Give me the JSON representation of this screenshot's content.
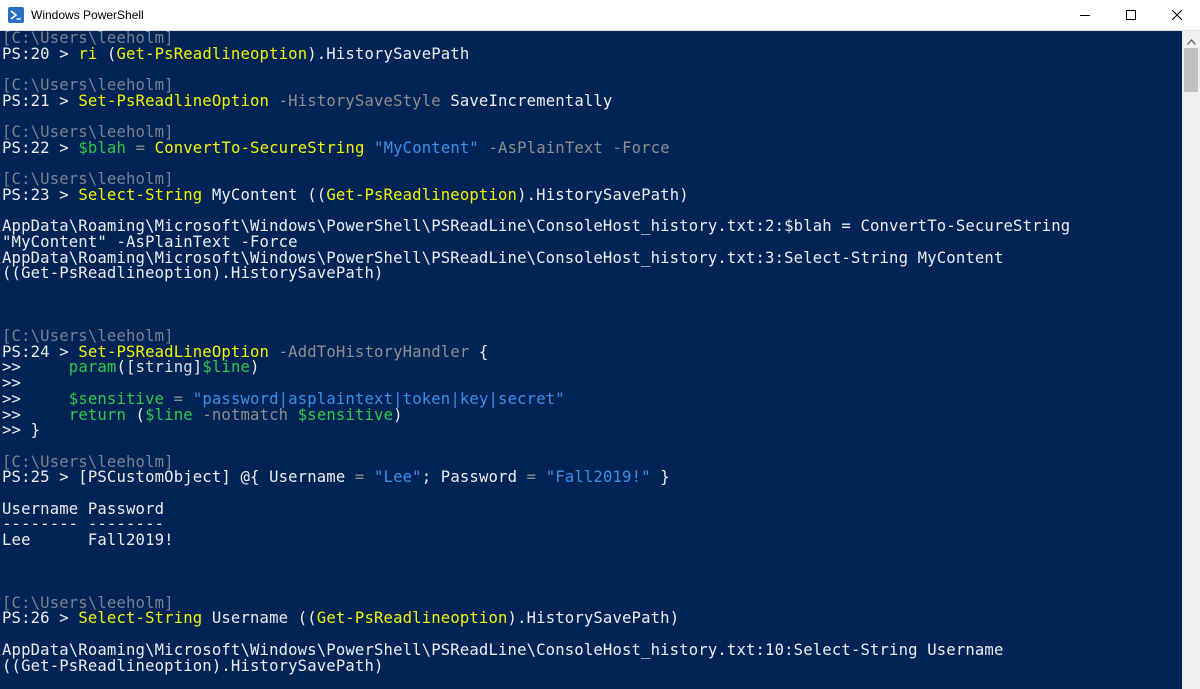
{
  "window": {
    "title": "Windows PowerShell",
    "icons": {
      "app": "powershell-icon",
      "minimize": "minimize-icon",
      "maximize": "maximize-icon",
      "close": "close-icon",
      "scroll_up": "chevron-up-icon"
    }
  },
  "colors": {
    "background": "#012456",
    "text": "#eeedf0",
    "prompt_path": "#7a8190",
    "command": "#f5f500",
    "parameter": "#8f8f8f",
    "variable": "#2ec84b",
    "string": "#3f8de6"
  },
  "console": {
    "lines": [
      [
        {
          "t": "[C:\\Users\\leeholm]",
          "c": "prompt"
        }
      ],
      [
        {
          "t": "PS:20 > "
        },
        {
          "t": "ri",
          "c": "cmd"
        },
        {
          "t": " ("
        },
        {
          "t": "Get-PsReadlineoption",
          "c": "cmd"
        },
        {
          "t": ").HistorySavePath"
        }
      ],
      [],
      [
        {
          "t": "[C:\\Users\\leeholm]",
          "c": "prompt"
        }
      ],
      [
        {
          "t": "PS:21 > "
        },
        {
          "t": "Set-PsReadlineOption",
          "c": "cmd"
        },
        {
          "t": " "
        },
        {
          "t": "-HistorySaveStyle",
          "c": "param"
        },
        {
          "t": " SaveIncrementally"
        }
      ],
      [],
      [
        {
          "t": "[C:\\Users\\leeholm]",
          "c": "prompt"
        }
      ],
      [
        {
          "t": "PS:22 > "
        },
        {
          "t": "$blah",
          "c": "var"
        },
        {
          "t": " "
        },
        {
          "t": "=",
          "c": "param"
        },
        {
          "t": " "
        },
        {
          "t": "ConvertTo-SecureString",
          "c": "cmd"
        },
        {
          "t": " "
        },
        {
          "t": "\"MyContent\"",
          "c": "str"
        },
        {
          "t": " "
        },
        {
          "t": "-AsPlainText",
          "c": "param"
        },
        {
          "t": " "
        },
        {
          "t": "-Force",
          "c": "param"
        }
      ],
      [],
      [
        {
          "t": "[C:\\Users\\leeholm]",
          "c": "prompt"
        }
      ],
      [
        {
          "t": "PS:23 > "
        },
        {
          "t": "Select-String",
          "c": "cmd"
        },
        {
          "t": " MyContent (("
        },
        {
          "t": "Get-PsReadlineoption",
          "c": "cmd"
        },
        {
          "t": ").HistorySavePath)"
        }
      ],
      [],
      [
        {
          "t": "AppData\\Roaming\\Microsoft\\Windows\\PowerShell\\PSReadLine\\ConsoleHost_history.txt:2:$blah = ConvertTo-SecureString"
        }
      ],
      [
        {
          "t": "\"MyContent\" -AsPlainText -Force"
        }
      ],
      [
        {
          "t": "AppData\\Roaming\\Microsoft\\Windows\\PowerShell\\PSReadLine\\ConsoleHost_history.txt:3:Select-String MyContent"
        }
      ],
      [
        {
          "t": "((Get-PsReadlineoption).HistorySavePath)"
        }
      ],
      [],
      [],
      [],
      [
        {
          "t": "[C:\\Users\\leeholm]",
          "c": "prompt"
        }
      ],
      [
        {
          "t": "PS:24 > "
        },
        {
          "t": "Set-PSReadLineOption",
          "c": "cmd"
        },
        {
          "t": " "
        },
        {
          "t": "-AddToHistoryHandler",
          "c": "param"
        },
        {
          "t": " {"
        }
      ],
      [
        {
          "t": ">>     "
        },
        {
          "t": "param",
          "c": "var"
        },
        {
          "t": "(["
        },
        {
          "t": "string",
          "c": "type"
        },
        {
          "t": "]"
        },
        {
          "t": "$line",
          "c": "var"
        },
        {
          "t": ")"
        }
      ],
      [
        {
          "t": ">>"
        }
      ],
      [
        {
          "t": ">>     "
        },
        {
          "t": "$sensitive",
          "c": "var"
        },
        {
          "t": " "
        },
        {
          "t": "=",
          "c": "param"
        },
        {
          "t": " "
        },
        {
          "t": "\"password|asplaintext|token|key|secret\"",
          "c": "str"
        }
      ],
      [
        {
          "t": ">>     "
        },
        {
          "t": "return",
          "c": "var"
        },
        {
          "t": " ("
        },
        {
          "t": "$line",
          "c": "var"
        },
        {
          "t": " "
        },
        {
          "t": "-notmatch",
          "c": "param"
        },
        {
          "t": " "
        },
        {
          "t": "$sensitive",
          "c": "var"
        },
        {
          "t": ")"
        }
      ],
      [
        {
          "t": ">> }"
        }
      ],
      [],
      [
        {
          "t": "[C:\\Users\\leeholm]",
          "c": "prompt"
        }
      ],
      [
        {
          "t": "PS:25 > [PSCustomObject] @{ Username "
        },
        {
          "t": "=",
          "c": "param"
        },
        {
          "t": " "
        },
        {
          "t": "\"Lee\"",
          "c": "str"
        },
        {
          "t": "; Password "
        },
        {
          "t": "=",
          "c": "param"
        },
        {
          "t": " "
        },
        {
          "t": "\"Fall2019!\"",
          "c": "str"
        },
        {
          "t": " }"
        }
      ],
      [],
      [
        {
          "t": "Username Password"
        }
      ],
      [
        {
          "t": "-------- --------"
        }
      ],
      [
        {
          "t": "Lee      Fall2019!"
        }
      ],
      [],
      [],
      [],
      [
        {
          "t": "[C:\\Users\\leeholm]",
          "c": "prompt"
        }
      ],
      [
        {
          "t": "PS:26 > "
        },
        {
          "t": "Select-String",
          "c": "cmd"
        },
        {
          "t": " Username (("
        },
        {
          "t": "Get-PsReadlineoption",
          "c": "cmd"
        },
        {
          "t": ").HistorySavePath)"
        }
      ],
      [],
      [
        {
          "t": "AppData\\Roaming\\Microsoft\\Windows\\PowerShell\\PSReadLine\\ConsoleHost_history.txt:10:Select-String Username"
        }
      ],
      [
        {
          "t": "((Get-PsReadlineoption).HistorySavePath)"
        }
      ]
    ]
  }
}
